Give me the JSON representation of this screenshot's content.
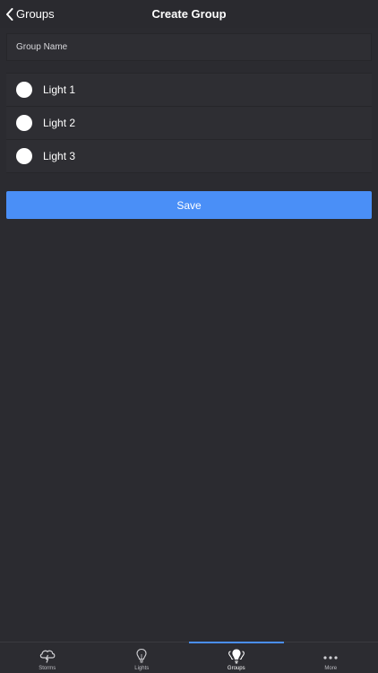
{
  "navbar": {
    "back_label": "Groups",
    "title": "Create Group"
  },
  "form": {
    "group_name_value": "",
    "group_name_placeholder": "Group Name"
  },
  "lights": [
    {
      "label": "Light 1",
      "selected": false
    },
    {
      "label": "Light 2",
      "selected": false
    },
    {
      "label": "Light 3",
      "selected": false
    }
  ],
  "save_label": "Save",
  "tabs": [
    {
      "label": "Storms",
      "icon": "storm-cloud-icon",
      "active": false
    },
    {
      "label": "Lights",
      "icon": "lightbulb-icon",
      "active": false
    },
    {
      "label": "Groups",
      "icon": "groups-icon",
      "active": true
    },
    {
      "label": "More",
      "icon": "more-dots-icon",
      "active": false
    }
  ],
  "colors": {
    "background": "#2b2b30",
    "accent": "#4a8ff7",
    "text": "#ffffff"
  }
}
